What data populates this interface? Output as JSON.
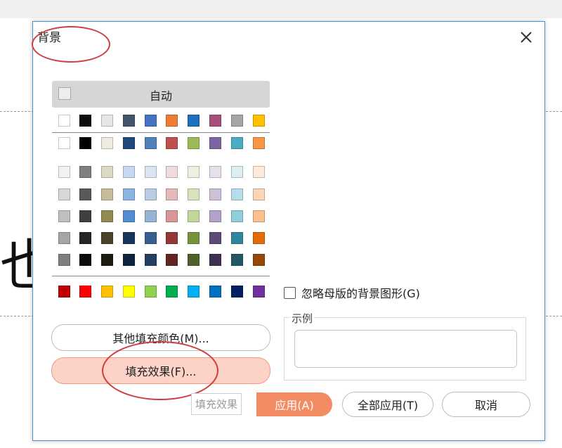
{
  "background": {
    "glyph": "也言"
  },
  "dialog": {
    "title": "背景",
    "close_icon": "close-icon",
    "palette": {
      "auto_label": "自动",
      "theme_row": [
        "#ffffff",
        "#0d0d0d",
        "#e7e6e6",
        "#44546a",
        "#4472c4",
        "#ed7d31",
        "#1f6fbf",
        "#a5507b",
        "#a5a5a5",
        "#ffc000"
      ],
      "theme_row2": [
        "#ffffff",
        "#000000",
        "#eeece1",
        "#1f497d",
        "#4f81bd",
        "#c0504d",
        "#9bbb59",
        "#8064a2",
        "#4bacc6",
        "#f79646"
      ],
      "tints": [
        [
          "#f2f2f2",
          "#7f7f7f",
          "#ddd9c3",
          "#c6d9f0",
          "#dbe5f1",
          "#f2dcdb",
          "#ebf1dd",
          "#e5e0ec",
          "#dbeef3",
          "#fdeada"
        ],
        [
          "#d8d8d8",
          "#595959",
          "#c4bd97",
          "#8db3e2",
          "#b8cce4",
          "#e5b9b7",
          "#d7e3bc",
          "#ccc1d9",
          "#b7dde8",
          "#fbd5b5"
        ],
        [
          "#bfbfbf",
          "#3f3f3f",
          "#938953",
          "#548dd4",
          "#95b3d7",
          "#d99694",
          "#c3d69b",
          "#b2a2c7",
          "#92cddc",
          "#fac08f"
        ],
        [
          "#a5a5a5",
          "#262626",
          "#494429",
          "#17365d",
          "#366092",
          "#953734",
          "#76923c",
          "#5f497a",
          "#31859b",
          "#e36c09"
        ],
        [
          "#7f7f7f",
          "#0c0c0c",
          "#1d1b10",
          "#0f243e",
          "#244061",
          "#632423",
          "#4f6128",
          "#3f3151",
          "#205867",
          "#974806"
        ]
      ],
      "standard": [
        "#c00000",
        "#ff0000",
        "#ffc000",
        "#ffff00",
        "#92d050",
        "#00b050",
        "#00b0f0",
        "#0070c0",
        "#002060",
        "#7030a0"
      ]
    },
    "more_colors_label": "其他填充颜色(M)...",
    "fill_effects_label": "填充效果(F)...",
    "ignore_master_label": "忽略母版的背景图形(G)",
    "sample_label": "示例",
    "tooltip_text": "填充效果",
    "apply_label": "应用(A)",
    "apply_all_label": "全部应用(T)",
    "cancel_label": "取消"
  }
}
